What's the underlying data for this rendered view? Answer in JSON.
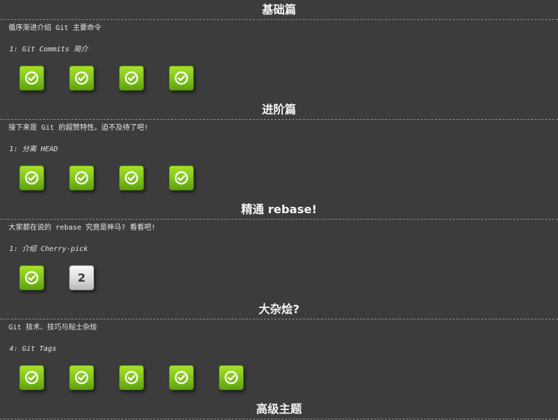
{
  "sections": [
    {
      "title": "基础篇",
      "description": "循序渐进介绍 Git 主要命令",
      "subtitle": "1: Git Commits 简介",
      "levels": [
        {
          "status": "solved",
          "icon": "check-icon"
        },
        {
          "status": "solved",
          "icon": "check-icon"
        },
        {
          "status": "solved",
          "icon": "check-icon"
        },
        {
          "status": "solved",
          "icon": "check-icon"
        }
      ]
    },
    {
      "title": "进阶篇",
      "description": "接下来是 Git 的超赞特性。迫不及待了吧!",
      "subtitle": "1: 分离 HEAD",
      "levels": [
        {
          "status": "solved",
          "icon": "check-icon"
        },
        {
          "status": "solved",
          "icon": "check-icon"
        },
        {
          "status": "solved",
          "icon": "check-icon"
        },
        {
          "status": "solved",
          "icon": "check-icon"
        }
      ]
    },
    {
      "title": "精通 rebase!",
      "description": "大家都在说的 rebase 究竟是神马? 看看吧!",
      "subtitle": "1: 介绍 Cherry-pick",
      "levels": [
        {
          "status": "solved",
          "icon": "check-icon"
        },
        {
          "status": "unsolved",
          "number": "2"
        }
      ]
    },
    {
      "title": "大杂烩?",
      "description": "Git 技术、技巧与贴士杂烩",
      "subtitle": "4: Git Tags",
      "levels": [
        {
          "status": "solved",
          "icon": "check-icon"
        },
        {
          "status": "solved",
          "icon": "check-icon"
        },
        {
          "status": "solved",
          "icon": "check-icon"
        },
        {
          "status": "solved",
          "icon": "check-icon"
        },
        {
          "status": "solved",
          "icon": "check-icon"
        }
      ]
    },
    {
      "title": "高级主题"
    }
  ],
  "colors": {
    "background": "#3c3c3c",
    "solved_top": "#a7e02a",
    "solved_bottom": "#5fa10c",
    "unsolved_top": "#f8f8f8",
    "unsolved_bottom": "#b9b9b9",
    "text": "#e6e6e6"
  }
}
